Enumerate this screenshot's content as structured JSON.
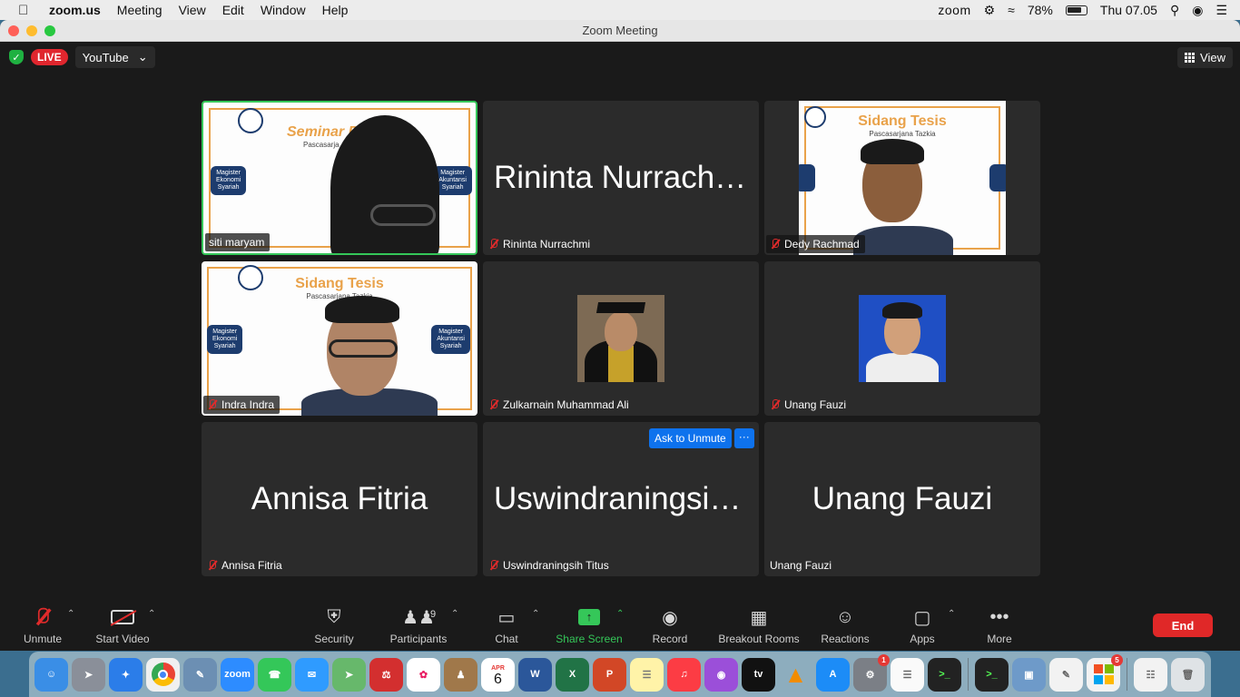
{
  "menubar": {
    "app_name": "zoom.us",
    "menus": [
      "Meeting",
      "View",
      "Edit",
      "Window",
      "Help"
    ],
    "status_app": "zoom",
    "battery": "78%",
    "clock": "Thu 07.05"
  },
  "window": {
    "title": "Zoom Meeting"
  },
  "topbar": {
    "live_label": "LIVE",
    "stream_target": "YouTube",
    "view_label": "View"
  },
  "tiles": [
    {
      "name": "siti maryam",
      "display": "video",
      "muted": false,
      "slide_title": "Seminar Pr",
      "slide_sub": "Pascasarja",
      "left_pill": "Magister\nEkonomi\nSyariah",
      "right_pill": "Magister\nAkuntansi\nSyariah"
    },
    {
      "name": "Rininta Nurrachmi",
      "display": "name",
      "muted": true
    },
    {
      "name": "Dedy Rachmad",
      "display": "video",
      "muted": true,
      "slide_title": "Sidang Tesis",
      "slide_sub": "Pascasarjana Tazkia"
    },
    {
      "name": "Indra Indra",
      "display": "video",
      "muted": true,
      "slide_title": "Sidang Tesis",
      "slide_sub": "Pascasarjana Tazkia",
      "left_pill": "Magister\nEkonomi\nSyariah",
      "right_pill": "Magister\nAkuntansi\nSyariah"
    },
    {
      "name": "Zulkarnain Muhammad Ali",
      "display": "photo",
      "muted": true
    },
    {
      "name": "Unang Fauzi",
      "display": "photo",
      "muted": true
    },
    {
      "name": "Annisa Fitria",
      "display": "name",
      "muted": true
    },
    {
      "name": "Uswindraningsih Titus",
      "big_name": "Uswindraningsih...",
      "display": "name",
      "muted": true
    },
    {
      "name": "Unang Fauzi",
      "display": "name",
      "muted": false
    }
  ],
  "ask_to_unmute": {
    "label": "Ask to Unmute",
    "more": "···"
  },
  "toolbar": {
    "unmute": "Unmute",
    "start_video": "Start Video",
    "security": "Security",
    "participants": "Participants",
    "participants_count": "9",
    "chat": "Chat",
    "share_screen": "Share Screen",
    "record": "Record",
    "breakout_rooms": "Breakout Rooms",
    "reactions": "Reactions",
    "apps": "Apps",
    "more": "More",
    "end": "End"
  },
  "dock": {
    "calendar_month": "APR",
    "calendar_day": "6",
    "settings_badge": "1",
    "office_badge": "5"
  },
  "colors": {
    "active_speaker": "#35c759",
    "end_button": "#e02828",
    "accent": "#0e72ed",
    "muted_icon": "#e02b2b"
  }
}
